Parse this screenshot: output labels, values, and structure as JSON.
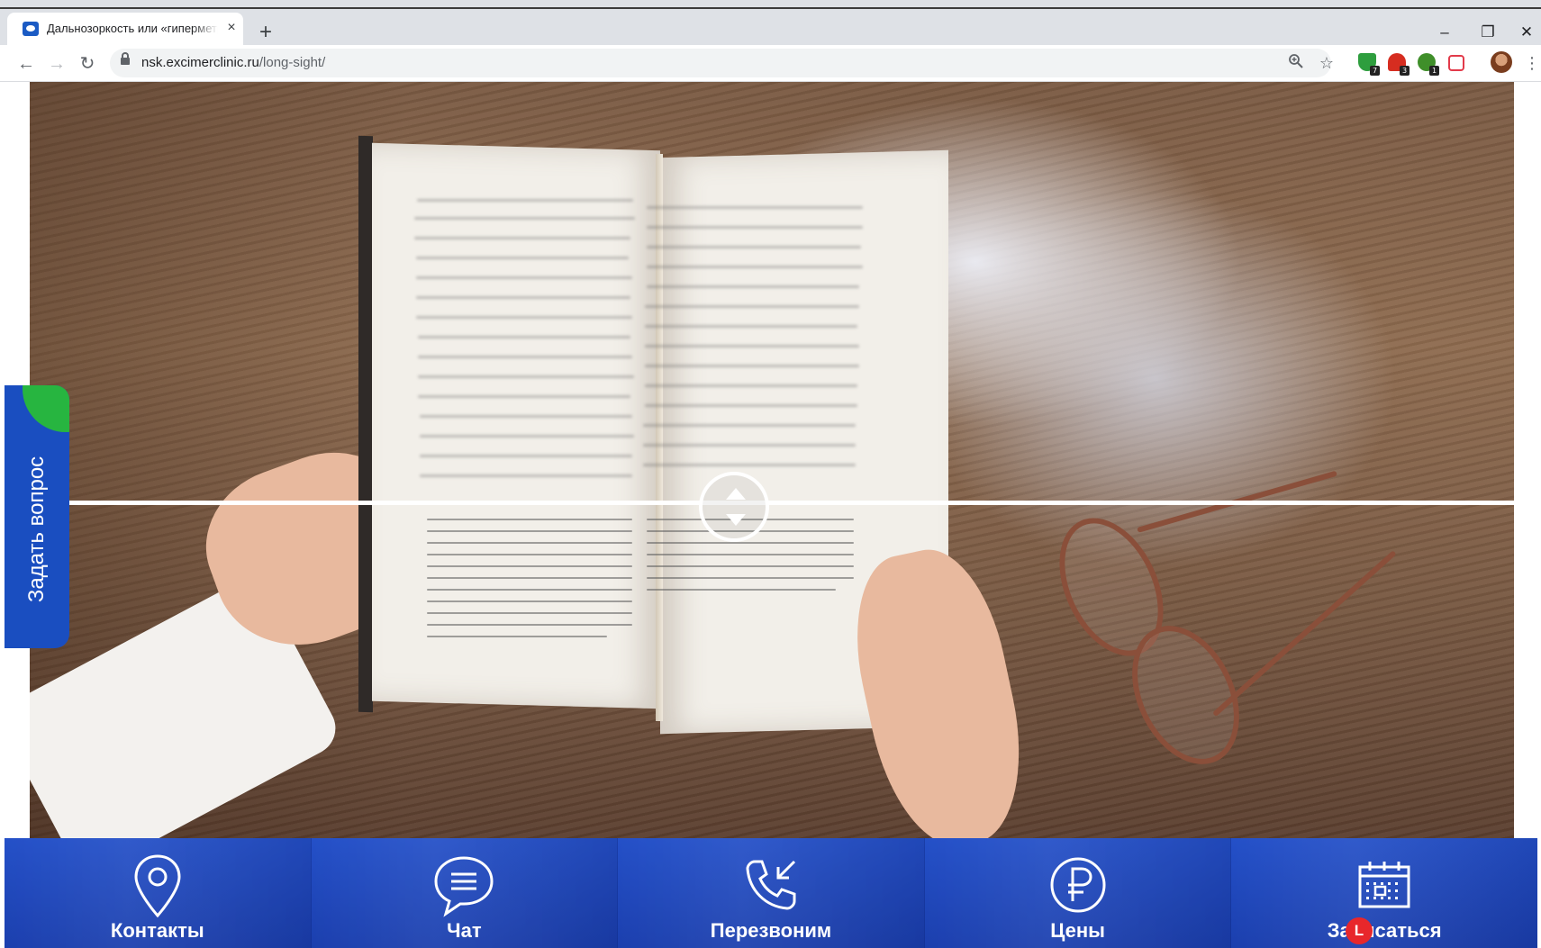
{
  "browser": {
    "tab_title": "Дальнозоркость или «гиперметропия»",
    "tab_close": "×",
    "new_tab": "+",
    "window_controls": {
      "minimize": "–",
      "restore": "❐",
      "close": "✕"
    },
    "nav": {
      "back": "←",
      "forward": "→",
      "reload": "↻"
    },
    "url": {
      "host": "nsk.excimerclinic.ru",
      "path": "/long-sight/"
    },
    "omnibox_icons": [
      "zoom-icon",
      "bookmark-star-icon"
    ],
    "extensions": [
      {
        "name": "extension-shield-green",
        "color": "#2e9e3e",
        "badge": "7"
      },
      {
        "name": "extension-shield-red",
        "color": "#d62d20",
        "badge": "3"
      },
      {
        "name": "extension-shield-darkgreen",
        "color": "#3f8f2a",
        "badge": "1"
      },
      {
        "name": "extension-pocket",
        "color": "#e23a4a",
        "badge": ""
      }
    ],
    "menu": "⋮"
  },
  "hero": {
    "compare_handle_icon": "up-down-arrows-icon"
  },
  "side_tab": {
    "label": "Задать вопрос",
    "accent_color": "#27b540",
    "bg_color": "#1a4ec0"
  },
  "bottom_nav": {
    "items": [
      {
        "label": "Контакты",
        "icon": "location-pin-icon"
      },
      {
        "label": "Чат",
        "icon": "chat-bubble-icon"
      },
      {
        "label": "Перезвоним",
        "icon": "phone-callback-icon"
      },
      {
        "label": "Цены",
        "icon": "ruble-icon"
      },
      {
        "label": "Записаться",
        "icon": "calendar-icon"
      }
    ],
    "notification_badge": "L",
    "bg_color": "#2450c8"
  }
}
